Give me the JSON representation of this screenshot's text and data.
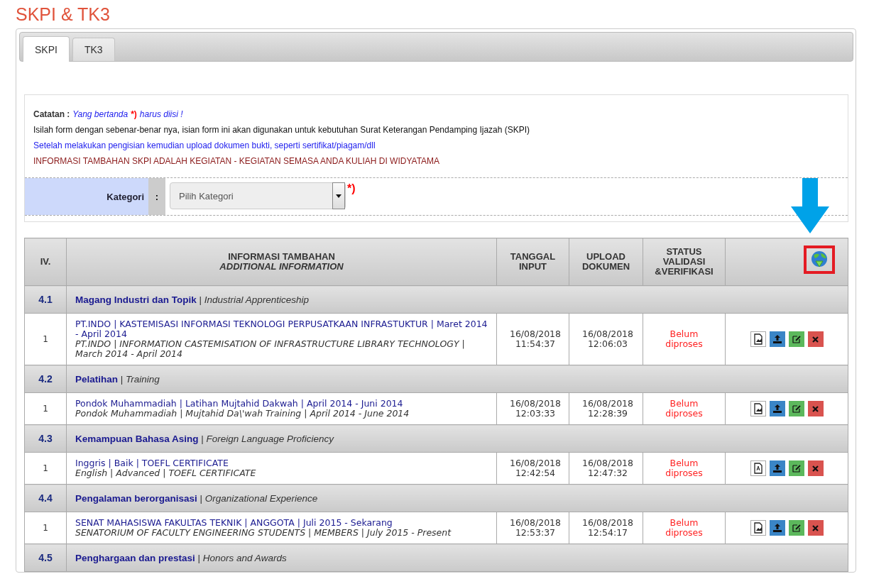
{
  "page_title": "SKPI & TK3",
  "tabs": [
    {
      "label": "SKPI",
      "selected": true
    },
    {
      "label": "TK3",
      "selected": false
    }
  ],
  "note": {
    "label": "Catatan :",
    "hint": "Yang bertanda",
    "mark": "*)",
    "hint_end": "harus diisi !",
    "lines": [
      {
        "kind": "plain",
        "text": "Isilah form dengan sebenar-benar nya, isian form ini akan digunakan untuk kebutuhan Surat Keterangan Pendamping Ijazah (SKPI)"
      },
      {
        "kind": "info",
        "text": "Setelah melakukan pengisian kemudian upload dokumen bukti, seperti sertifikat/piagam/dll"
      },
      {
        "kind": "warning",
        "text": "INFORMASI TAMBAHAN SKPI ADALAH KEGIATAN - KEGIATAN SEMASA ANDA KULIAH DI WIDYATAMA"
      }
    ]
  },
  "category_field": {
    "label": "Kategori",
    "separator": ":",
    "value": "Pilih Kategori",
    "required_mark": "*)"
  },
  "table": {
    "columns": [
      {
        "label": "IV."
      },
      {
        "label": "INFORMASI TAMBAHAN",
        "sublabel": "ADDITIONAL INFORMATION"
      },
      {
        "label": "TANGGAL INPUT"
      },
      {
        "label": "UPLOAD DOKUMEN"
      },
      {
        "label": "STATUS VALIDASI &VERIFIKASI"
      }
    ],
    "sections": [
      {
        "number": "4.1",
        "title": "**Magang Industri dan Topik** | *Industrial Apprenticeship*",
        "rows": [
          {
            "number": "1",
            "title": "PT.INDO | KASTEMISASI INFORMASI TEKNOLOGI PERPUSATKAAN INFRASTUKTUR | Maret 2014 - April 2014",
            "subtitle": "PT.INDO | INFORMATION CASTEMISATION OF INFRASTRUCTURE LIBRARY TECHNOLOGY | March 2014 - April 2014",
            "input_date": "16/08/2018 11:54:37",
            "upload_date": "16/08/2018 12:06:03",
            "status": "Belum diproses",
            "kind": "image"
          }
        ]
      },
      {
        "number": "4.2",
        "title": "**Pelatihan** | *Training*",
        "rows": [
          {
            "number": "1",
            "title": "Pondok Muhammadiah | Latihan Mujtahid Dakwah | April 2014 - Juni 2014",
            "subtitle": "Pondok Muhammadiah | Mujtahid Da\\'wah Training | April 2014 - June 2014",
            "input_date": "16/08/2018 12:03:33",
            "upload_date": "16/08/2018 12:28:39",
            "status": "Belum diproses",
            "kind": "image"
          }
        ]
      },
      {
        "number": "4.3",
        "title": "**Kemampuan Bahasa Asing** | *Foreign Language Proficiency*",
        "rows": [
          {
            "number": "1",
            "title": "Inggris | Baik | TOEFL CERTIFICATE",
            "subtitle": "English | Advanced | TOEFL CERTIFICATE",
            "input_date": "16/08/2018 12:42:54",
            "upload_date": "16/08/2018 12:47:32",
            "status": "Belum diproses",
            "kind": "pdf"
          }
        ]
      },
      {
        "number": "4.4",
        "title": "**Pengalaman berorganisasi** | *Organizational Experience*",
        "rows": [
          {
            "number": "1",
            "title": "SENAT MAHASISWA FAKULTAS TEKNIK | ANGGOTA | Juli 2015 - Sekarang",
            "subtitle": "SENATORIUM OF FACULTY ENGINEERING STUDENTS | MEMBERS | July 2015 - Present",
            "input_date": "16/08/2018 12:53:37",
            "upload_date": "16/08/2018 12:54:17",
            "status": "Belum diproses",
            "kind": "image"
          }
        ]
      },
      {
        "number": "4.5",
        "title": "**Penghargaan dan prestasi** | *Honors and Awards*"
      }
    ]
  }
}
